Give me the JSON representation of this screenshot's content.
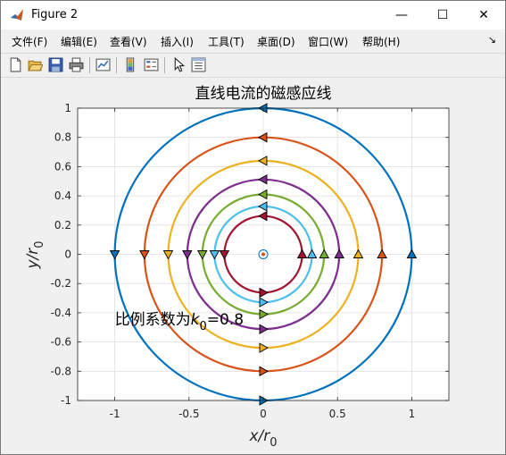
{
  "window": {
    "title": "Figure 2",
    "minimize_glyph": "—",
    "maximize_glyph": "☐",
    "close_glyph": "✕"
  },
  "menu": {
    "items": [
      "文件(F)",
      "编辑(E)",
      "查看(V)",
      "插入(I)",
      "工具(T)",
      "桌面(D)",
      "窗口(W)",
      "帮助(H)"
    ],
    "overflow_glyph": "↘"
  },
  "toolbar": {
    "icons": [
      "new-figure-icon",
      "open-file-icon",
      "save-icon",
      "print-icon",
      "link-plot-icon",
      "insert-colorbar-icon",
      "insert-legend-icon",
      "edit-plot-icon",
      "property-inspector-icon"
    ]
  },
  "chart_data": {
    "type": "line",
    "title": "直线电流的磁感应线",
    "xlabel": "x/r",
    "xlabel_sub": "0",
    "ylabel": "y/r",
    "ylabel_sub": "0",
    "xlim": [
      -1.25,
      1.25
    ],
    "ylim": [
      -1,
      1
    ],
    "xticks": [
      -1,
      -0.5,
      0,
      0.5,
      1
    ],
    "xtick_labels": [
      "-1",
      "-0.5",
      "0",
      "0.5",
      "1"
    ],
    "yticks": [
      1,
      0.8,
      0.6,
      0.4,
      0.2,
      0,
      -0.2,
      -0.4,
      -0.6,
      -0.8,
      -1
    ],
    "ytick_labels": [
      "1",
      "0.8",
      "0.6",
      "0.4",
      "0.2",
      "0",
      "-0.2",
      "-0.4",
      "-0.6",
      "-0.8",
      "-1"
    ],
    "grid": true,
    "annotation": "比例系数为",
    "annotation_var": "k",
    "annotation_sub": "0",
    "annotation_value": "=0.8",
    "annotation_pos": [
      -1,
      -0.48
    ],
    "center_marker": [
      0,
      0
    ],
    "series": [
      {
        "radius": 1.0,
        "color": "#0072bd"
      },
      {
        "radius": 0.8,
        "color": "#d95319"
      },
      {
        "radius": 0.64,
        "color": "#edb120"
      },
      {
        "radius": 0.512,
        "color": "#7e2f8e"
      },
      {
        "radius": 0.41,
        "color": "#77ac30"
      },
      {
        "radius": 0.328,
        "color": "#4dbeee"
      },
      {
        "radius": 0.262,
        "color": "#a2142f"
      }
    ]
  }
}
